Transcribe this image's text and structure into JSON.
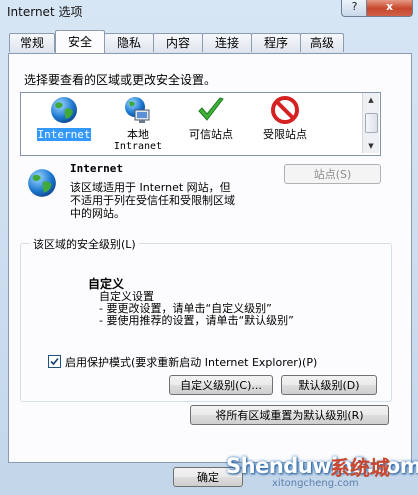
{
  "window": {
    "title": "Internet 选项",
    "help_label": "?",
    "close_label": "x"
  },
  "tabs": [
    {
      "label": "常规"
    },
    {
      "label": "安全"
    },
    {
      "label": "隐私"
    },
    {
      "label": "内容"
    },
    {
      "label": "连接"
    },
    {
      "label": "程序"
    },
    {
      "label": "高级"
    }
  ],
  "active_tab": "安全",
  "security": {
    "prompt": "选择要查看的区域或更改安全设置。",
    "zones": [
      {
        "label": "Internet",
        "label2": "",
        "icon": "globe-icon",
        "selected": true
      },
      {
        "label": "本地",
        "label2": "Intranet",
        "icon": "local-intranet-icon"
      },
      {
        "label": "可信站点",
        "label2": "",
        "icon": "checkmark-icon"
      },
      {
        "label": "受限站点",
        "label2": "",
        "icon": "prohibited-icon"
      }
    ],
    "zone_title": "Internet",
    "zone_desc": [
      "该区域适用于 Internet 网站，但",
      "不适用于列在受信任和受限制区域",
      "中的网站。"
    ],
    "sites_button": "站点(S)",
    "level_group_label": "该区域的安全级别(L)",
    "level_name": "自定义",
    "level_desc": [
      "自定义设置",
      "- 要更改设置，请单击“自定义级别”",
      "- 要使用推荐的设置，请单击“默认级别”"
    ],
    "protected_mode_label": "启用保护模式(要求重新启动 Internet Explorer)(P)",
    "protected_mode_checked": true,
    "custom_level_button": "自定义级别(C)...",
    "default_level_button": "默认级别(D)",
    "reset_all_button": "将所有区域重置为默认级别(R)"
  },
  "footer": {
    "ok_button": "确定"
  },
  "watermark": {
    "main": "Shenduwin8.com",
    "sub": "xitongcheng.com",
    "cn": "系统城"
  },
  "colors": {
    "selection": "#3399ff",
    "accent": "#2a6fb5"
  }
}
